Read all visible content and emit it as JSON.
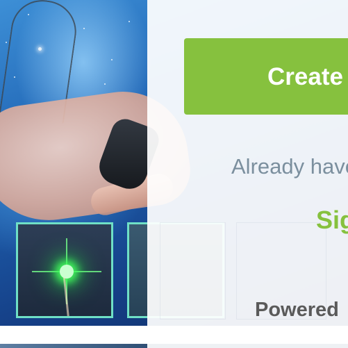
{
  "create_button": {
    "label": "Create"
  },
  "login_prompt": {
    "text": "Already have"
  },
  "signin_link": {
    "label": "Sig"
  },
  "footer": {
    "powered_by": "Powered"
  },
  "colors": {
    "accent_green": "#86c13e",
    "muted_text": "#7b8f9e",
    "thumbnail_border": "#6fe0c6"
  },
  "icons": {
    "thumbnail_1": "green-light-photo",
    "thumbnail_2": "candle-photo"
  }
}
